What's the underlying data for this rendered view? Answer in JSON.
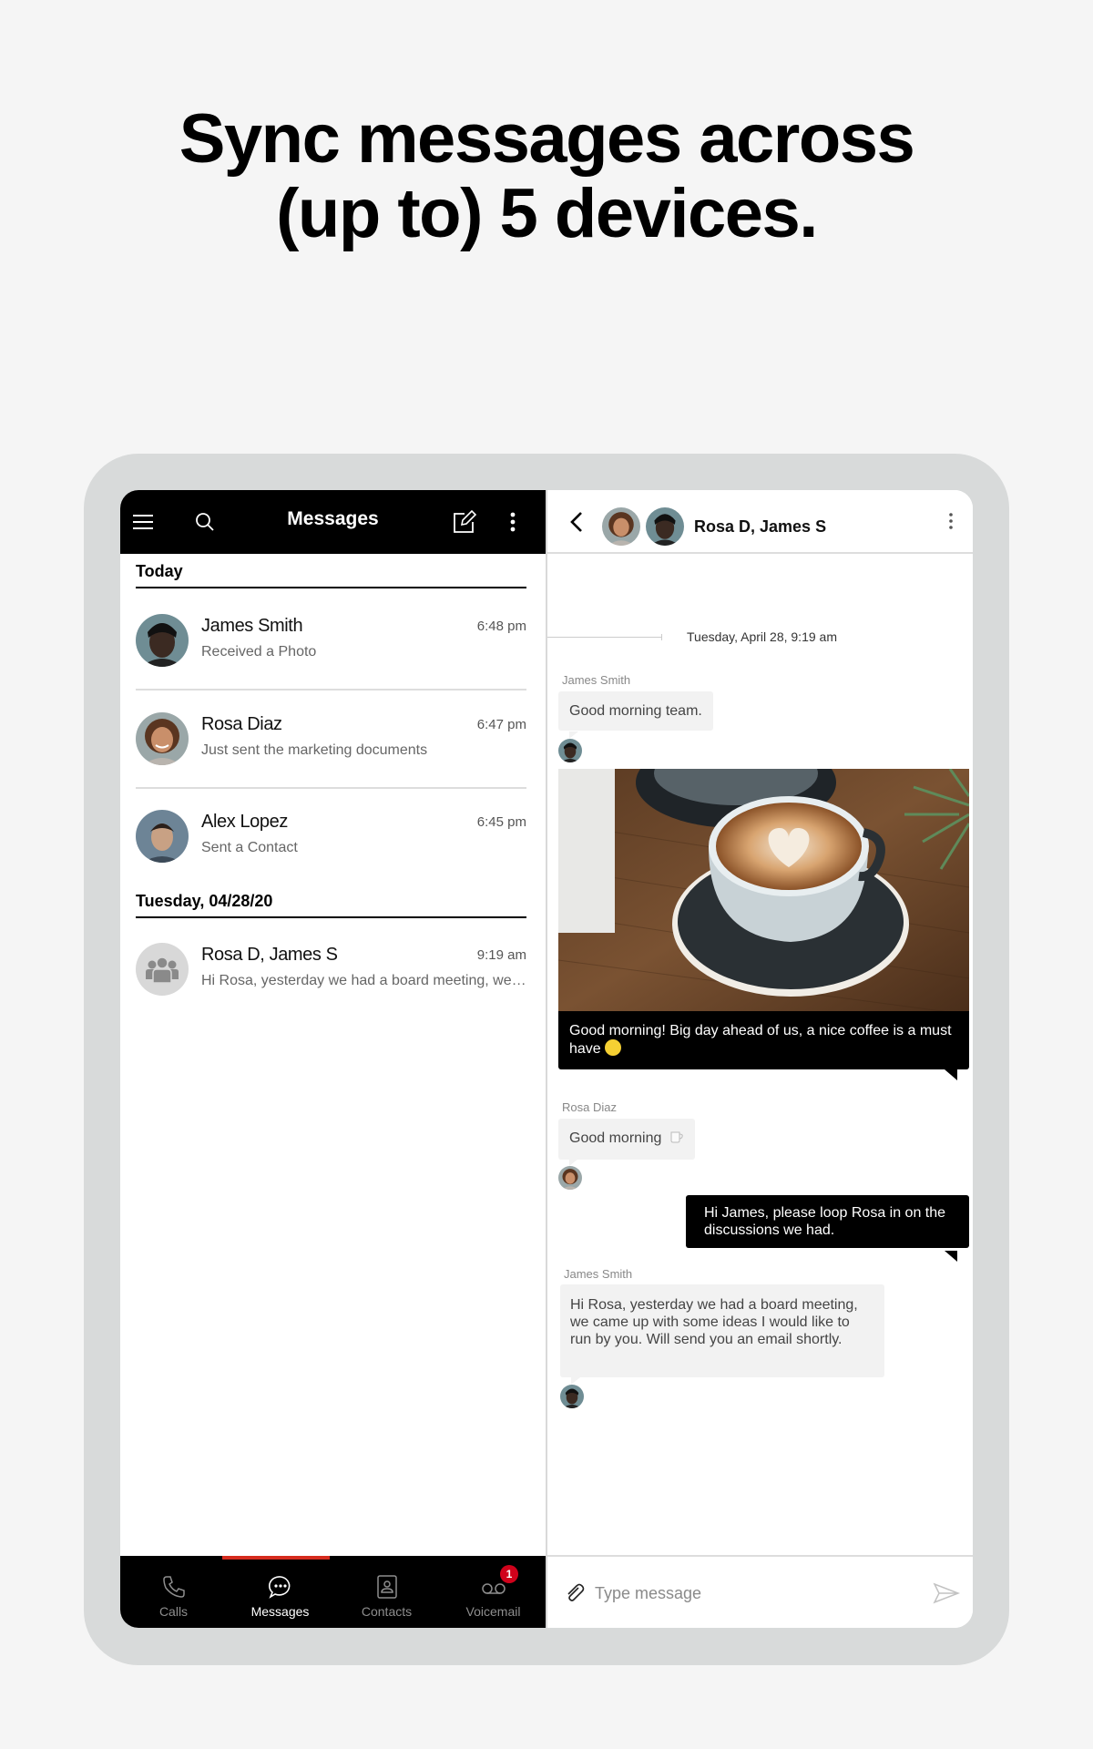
{
  "headline": {
    "line1": "Sync messages across",
    "line2": "(up to) 5 devices."
  },
  "colors": {
    "accent": "#d52b1e",
    "badge": "#d0021b",
    "header_bg": "#000000",
    "frame": "#d8dada",
    "page_bg": "#f5f5f5"
  },
  "left_panel": {
    "header": {
      "menu_icon": "hamburger-menu-icon",
      "search_icon": "search-icon",
      "title": "Messages",
      "compose_icon": "compose-icon",
      "more_icon": "more-vertical-icon"
    },
    "sections": [
      {
        "label": "Today",
        "conversations": [
          {
            "name": "James Smith",
            "time": "6:48 pm",
            "snippet": "Received a Photo",
            "avatar": "james-smith"
          },
          {
            "name": "Rosa Diaz",
            "time": "6:47 pm",
            "snippet": "Just sent the marketing documents",
            "avatar": "rosa-diaz"
          },
          {
            "name": "Alex Lopez",
            "time": "6:45 pm",
            "snippet": "Sent a Contact",
            "avatar": "alex-lopez"
          }
        ]
      },
      {
        "label": "Tuesday, 04/28/20",
        "conversations": [
          {
            "name": "Rosa D, James S",
            "time": "9:19 am",
            "snippet": "Hi Rosa, yesterday we had a board meeting, we came up with some ideas I would like to run by you. Will send you an email shortly.",
            "avatar": "group"
          }
        ]
      }
    ],
    "bottom_nav": [
      {
        "label": "Calls",
        "icon": "phone-icon",
        "active": false
      },
      {
        "label": "Messages",
        "icon": "chat-bubble-icon",
        "active": true
      },
      {
        "label": "Contacts",
        "icon": "contact-card-icon",
        "active": false
      },
      {
        "label": "Voicemail",
        "icon": "voicemail-icon",
        "active": false,
        "badge": "1"
      }
    ]
  },
  "right_panel": {
    "header": {
      "back_icon": "chevron-left-icon",
      "title": "Rosa D, James S",
      "more_icon": "more-vertical-icon"
    },
    "date_separator": "Tuesday, April 28, 9:19 am",
    "messages": [
      {
        "sender": "James Smith",
        "direction": "in",
        "text": "Good morning team."
      },
      {
        "sender": "James Smith",
        "direction": "out",
        "type": "photo",
        "caption": "Good morning! Big day ahead of us, a nice coffee is a must have",
        "caption_emoji": "slightly-smiling-face"
      },
      {
        "sender": "Rosa Diaz",
        "direction": "in",
        "text": "Good morning",
        "emoji": "coffee-cup"
      },
      {
        "sender": "",
        "direction": "out",
        "text": "Hi James, please loop Rosa in on the discussions we had."
      },
      {
        "sender": "James Smith",
        "direction": "in",
        "text": "Hi Rosa, yesterday we had a board meeting, we came up with some ideas I would like to run by you. Will send you an email shortly."
      }
    ],
    "composer": {
      "placeholder": "Type message",
      "value": "",
      "attach_icon": "paperclip-icon",
      "send_icon": "send-icon"
    }
  }
}
